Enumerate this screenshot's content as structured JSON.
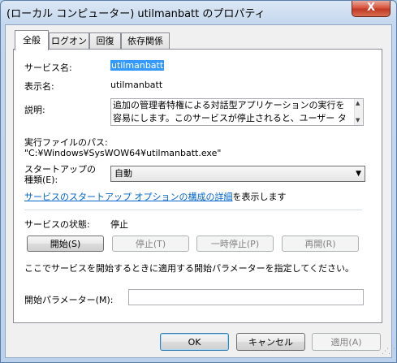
{
  "window": {
    "title": "(ローカル コンピューター) utilmanbatt のプロパティ",
    "close_glyph": "X"
  },
  "tabs": [
    {
      "label": "全般",
      "active": true
    },
    {
      "label": "ログオン",
      "active": false
    },
    {
      "label": "回復",
      "active": false
    },
    {
      "label": "依存関係",
      "active": false
    }
  ],
  "general": {
    "service_name_label": "サービス名:",
    "service_name_value": "utilmanbatt",
    "display_name_label": "表示名:",
    "display_name_value": "utilmanbatt",
    "description_label": "説明:",
    "description_value": "追加の管理者特権による対話型アプリケーションの実行を容易にします。このサービスが停止されると、ユーザー タスクの実行に",
    "path_label": "実行ファイルのパス:",
    "path_value": "\"C:¥Windows¥SysWOW64¥utilmanbatt.exe\"",
    "startup_type_label": "スタートアップの\n種類(E):",
    "startup_type_label_line1": "スタートアップの",
    "startup_type_label_line2": "種類(E):",
    "startup_type_value": "自動",
    "help_link": "サービスのスタートアップ オプションの構成の詳細",
    "help_suffix": "を表示します",
    "status_label": "サービスの状態:",
    "status_value": "停止",
    "buttons": {
      "start": "開始(S)",
      "stop": "停止(T)",
      "pause": "一時停止(P)",
      "resume": "再開(R)"
    },
    "start_hint": "ここでサービスを開始するときに適用する開始パラメーターを指定してください。",
    "start_params_label": "開始パラメーター(M):",
    "start_params_value": ""
  },
  "footer": {
    "ok": "OK",
    "cancel": "キャンセル",
    "apply": "適用(A)"
  }
}
